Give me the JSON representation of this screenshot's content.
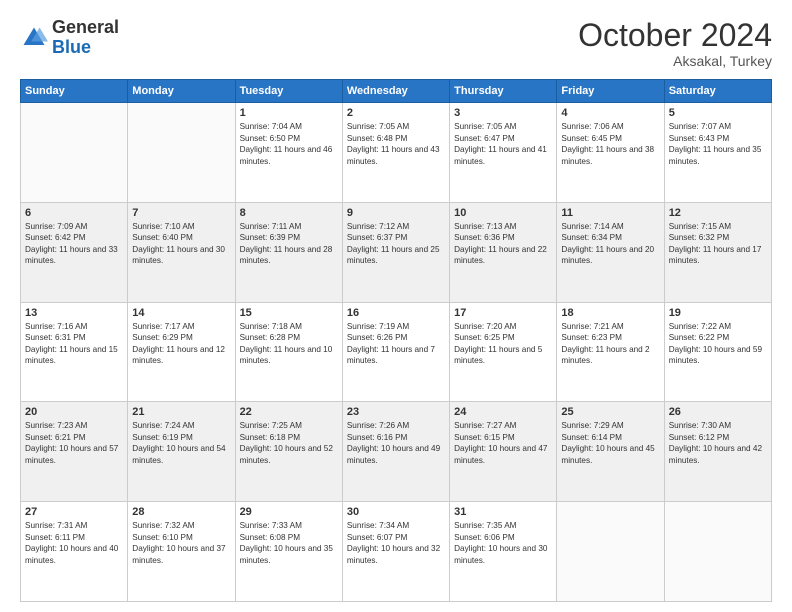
{
  "logo": {
    "general": "General",
    "blue": "Blue"
  },
  "header": {
    "month": "October 2024",
    "location": "Aksakal, Turkey"
  },
  "weekdays": [
    "Sunday",
    "Monday",
    "Tuesday",
    "Wednesday",
    "Thursday",
    "Friday",
    "Saturday"
  ],
  "weeks": [
    [
      {
        "day": "",
        "sunrise": "",
        "sunset": "",
        "daylight": ""
      },
      {
        "day": "",
        "sunrise": "",
        "sunset": "",
        "daylight": ""
      },
      {
        "day": "1",
        "sunrise": "Sunrise: 7:04 AM",
        "sunset": "Sunset: 6:50 PM",
        "daylight": "Daylight: 11 hours and 46 minutes."
      },
      {
        "day": "2",
        "sunrise": "Sunrise: 7:05 AM",
        "sunset": "Sunset: 6:48 PM",
        "daylight": "Daylight: 11 hours and 43 minutes."
      },
      {
        "day": "3",
        "sunrise": "Sunrise: 7:05 AM",
        "sunset": "Sunset: 6:47 PM",
        "daylight": "Daylight: 11 hours and 41 minutes."
      },
      {
        "day": "4",
        "sunrise": "Sunrise: 7:06 AM",
        "sunset": "Sunset: 6:45 PM",
        "daylight": "Daylight: 11 hours and 38 minutes."
      },
      {
        "day": "5",
        "sunrise": "Sunrise: 7:07 AM",
        "sunset": "Sunset: 6:43 PM",
        "daylight": "Daylight: 11 hours and 35 minutes."
      }
    ],
    [
      {
        "day": "6",
        "sunrise": "Sunrise: 7:09 AM",
        "sunset": "Sunset: 6:42 PM",
        "daylight": "Daylight: 11 hours and 33 minutes."
      },
      {
        "day": "7",
        "sunrise": "Sunrise: 7:10 AM",
        "sunset": "Sunset: 6:40 PM",
        "daylight": "Daylight: 11 hours and 30 minutes."
      },
      {
        "day": "8",
        "sunrise": "Sunrise: 7:11 AM",
        "sunset": "Sunset: 6:39 PM",
        "daylight": "Daylight: 11 hours and 28 minutes."
      },
      {
        "day": "9",
        "sunrise": "Sunrise: 7:12 AM",
        "sunset": "Sunset: 6:37 PM",
        "daylight": "Daylight: 11 hours and 25 minutes."
      },
      {
        "day": "10",
        "sunrise": "Sunrise: 7:13 AM",
        "sunset": "Sunset: 6:36 PM",
        "daylight": "Daylight: 11 hours and 22 minutes."
      },
      {
        "day": "11",
        "sunrise": "Sunrise: 7:14 AM",
        "sunset": "Sunset: 6:34 PM",
        "daylight": "Daylight: 11 hours and 20 minutes."
      },
      {
        "day": "12",
        "sunrise": "Sunrise: 7:15 AM",
        "sunset": "Sunset: 6:32 PM",
        "daylight": "Daylight: 11 hours and 17 minutes."
      }
    ],
    [
      {
        "day": "13",
        "sunrise": "Sunrise: 7:16 AM",
        "sunset": "Sunset: 6:31 PM",
        "daylight": "Daylight: 11 hours and 15 minutes."
      },
      {
        "day": "14",
        "sunrise": "Sunrise: 7:17 AM",
        "sunset": "Sunset: 6:29 PM",
        "daylight": "Daylight: 11 hours and 12 minutes."
      },
      {
        "day": "15",
        "sunrise": "Sunrise: 7:18 AM",
        "sunset": "Sunset: 6:28 PM",
        "daylight": "Daylight: 11 hours and 10 minutes."
      },
      {
        "day": "16",
        "sunrise": "Sunrise: 7:19 AM",
        "sunset": "Sunset: 6:26 PM",
        "daylight": "Daylight: 11 hours and 7 minutes."
      },
      {
        "day": "17",
        "sunrise": "Sunrise: 7:20 AM",
        "sunset": "Sunset: 6:25 PM",
        "daylight": "Daylight: 11 hours and 5 minutes."
      },
      {
        "day": "18",
        "sunrise": "Sunrise: 7:21 AM",
        "sunset": "Sunset: 6:23 PM",
        "daylight": "Daylight: 11 hours and 2 minutes."
      },
      {
        "day": "19",
        "sunrise": "Sunrise: 7:22 AM",
        "sunset": "Sunset: 6:22 PM",
        "daylight": "Daylight: 10 hours and 59 minutes."
      }
    ],
    [
      {
        "day": "20",
        "sunrise": "Sunrise: 7:23 AM",
        "sunset": "Sunset: 6:21 PM",
        "daylight": "Daylight: 10 hours and 57 minutes."
      },
      {
        "day": "21",
        "sunrise": "Sunrise: 7:24 AM",
        "sunset": "Sunset: 6:19 PM",
        "daylight": "Daylight: 10 hours and 54 minutes."
      },
      {
        "day": "22",
        "sunrise": "Sunrise: 7:25 AM",
        "sunset": "Sunset: 6:18 PM",
        "daylight": "Daylight: 10 hours and 52 minutes."
      },
      {
        "day": "23",
        "sunrise": "Sunrise: 7:26 AM",
        "sunset": "Sunset: 6:16 PM",
        "daylight": "Daylight: 10 hours and 49 minutes."
      },
      {
        "day": "24",
        "sunrise": "Sunrise: 7:27 AM",
        "sunset": "Sunset: 6:15 PM",
        "daylight": "Daylight: 10 hours and 47 minutes."
      },
      {
        "day": "25",
        "sunrise": "Sunrise: 7:29 AM",
        "sunset": "Sunset: 6:14 PM",
        "daylight": "Daylight: 10 hours and 45 minutes."
      },
      {
        "day": "26",
        "sunrise": "Sunrise: 7:30 AM",
        "sunset": "Sunset: 6:12 PM",
        "daylight": "Daylight: 10 hours and 42 minutes."
      }
    ],
    [
      {
        "day": "27",
        "sunrise": "Sunrise: 7:31 AM",
        "sunset": "Sunset: 6:11 PM",
        "daylight": "Daylight: 10 hours and 40 minutes."
      },
      {
        "day": "28",
        "sunrise": "Sunrise: 7:32 AM",
        "sunset": "Sunset: 6:10 PM",
        "daylight": "Daylight: 10 hours and 37 minutes."
      },
      {
        "day": "29",
        "sunrise": "Sunrise: 7:33 AM",
        "sunset": "Sunset: 6:08 PM",
        "daylight": "Daylight: 10 hours and 35 minutes."
      },
      {
        "day": "30",
        "sunrise": "Sunrise: 7:34 AM",
        "sunset": "Sunset: 6:07 PM",
        "daylight": "Daylight: 10 hours and 32 minutes."
      },
      {
        "day": "31",
        "sunrise": "Sunrise: 7:35 AM",
        "sunset": "Sunset: 6:06 PM",
        "daylight": "Daylight: 10 hours and 30 minutes."
      },
      {
        "day": "",
        "sunrise": "",
        "sunset": "",
        "daylight": ""
      },
      {
        "day": "",
        "sunrise": "",
        "sunset": "",
        "daylight": ""
      }
    ]
  ]
}
